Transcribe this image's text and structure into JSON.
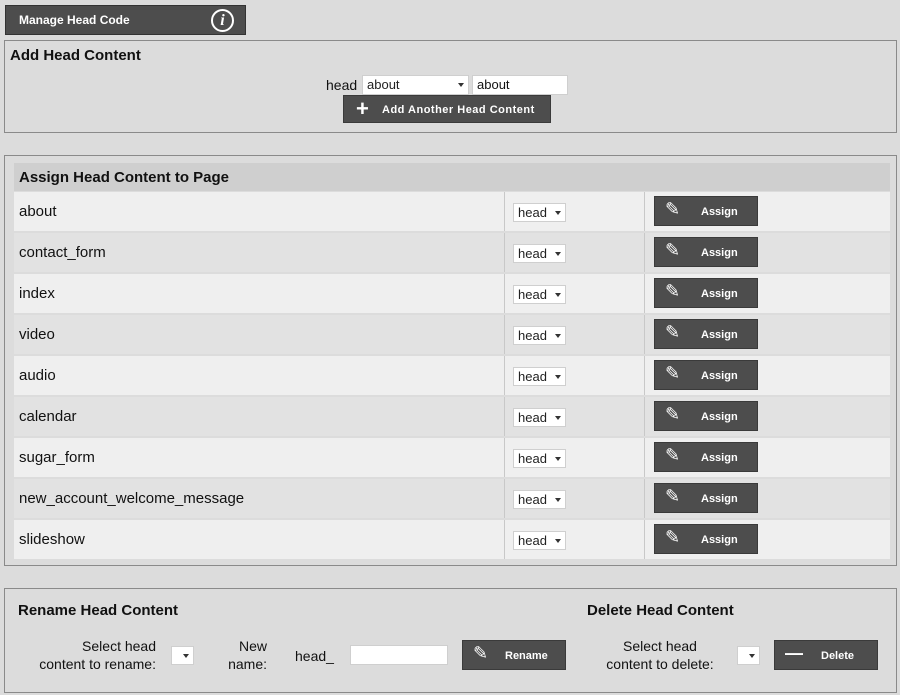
{
  "header": {
    "title": "Manage Head Code",
    "info_icon": "info-icon"
  },
  "add_section": {
    "title": "Add Head Content",
    "prefix_label": "head",
    "select_value": "about",
    "input_value": "about",
    "add_button": "Add Another Head Content"
  },
  "assign_section": {
    "title": "Assign Head Content to Page",
    "button_label": "Assign",
    "rows": [
      {
        "page": "about",
        "head": "head"
      },
      {
        "page": "contact_form",
        "head": "head"
      },
      {
        "page": "index",
        "head": "head"
      },
      {
        "page": "video",
        "head": "head"
      },
      {
        "page": "audio",
        "head": "head"
      },
      {
        "page": "calendar",
        "head": "head"
      },
      {
        "page": "sugar_form",
        "head": "head"
      },
      {
        "page": "new_account_welcome_message",
        "head": "head"
      },
      {
        "page": "slideshow",
        "head": "head"
      }
    ]
  },
  "rename_section": {
    "title": "Rename Head Content",
    "select_label_1": "Select head",
    "select_label_2": "content to rename:",
    "new_name_label_1": "New",
    "new_name_label_2": "name:",
    "prefix": "head_",
    "button_label": "Rename"
  },
  "delete_section": {
    "title": "Delete Head Content",
    "select_label_1": "Select head",
    "select_label_2": "content to delete:",
    "button_label": "Delete"
  }
}
